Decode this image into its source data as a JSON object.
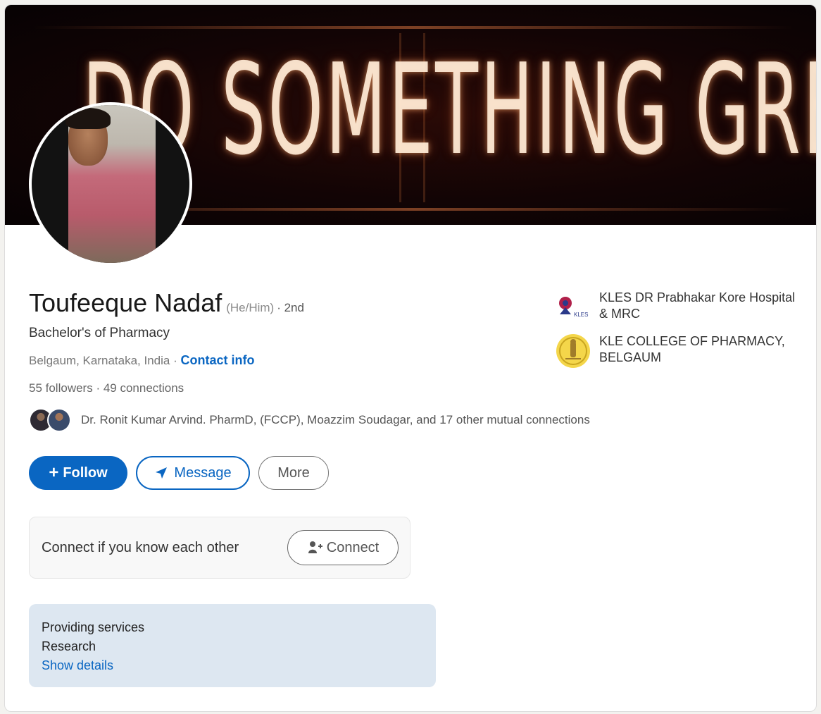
{
  "banner": {
    "text": "DO SOMETHING GREAT"
  },
  "profile": {
    "name": "Toufeeque Nadaf",
    "pronouns": "(He/Him)",
    "degree": "· 2nd",
    "headline": "Bachelor's of Pharmacy",
    "location": "Belgaum, Karnataka, India ·",
    "contact_info": "Contact info",
    "followers": "55 followers",
    "connections": " · 49 connections",
    "mutual_connections": "Dr. Ronit Kumar Arvind. PharmD, (FCCP), Moazzim Soudagar, and 17 other mutual connections"
  },
  "actions": {
    "follow_label": "Follow",
    "follow_icon": "plus-icon",
    "message_label": "Message",
    "message_icon": "send-icon",
    "more_label": "More"
  },
  "connect_prompt": {
    "text": "Connect if you know each other",
    "button_label": "Connect",
    "button_icon": "add-person-icon"
  },
  "services": {
    "title": "Providing services",
    "value": "Research",
    "link": "Show details"
  },
  "organizations": [
    {
      "name": "KLES DR Prabhakar Kore Hospital & MRC",
      "logo_text": "KLES"
    },
    {
      "name": "KLE COLLEGE OF PHARMACY, BELGAUM"
    }
  ],
  "colors": {
    "accent": "#0a66c2",
    "services_bg": "#dde7f1"
  }
}
